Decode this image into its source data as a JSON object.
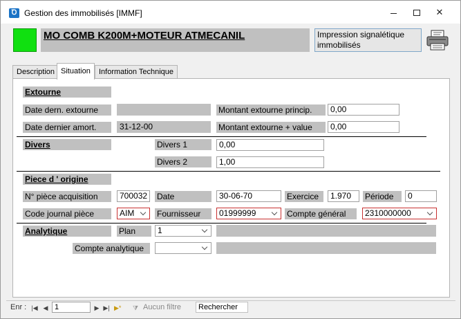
{
  "window": {
    "title": "Gestion des immobilisés [IMMF]"
  },
  "header": {
    "asset_name": "MO COMB K200M+MOTEUR ATMECANIL",
    "print_label": "Impression signalétique immobilisés",
    "status_color": "#10e010"
  },
  "tabs": [
    {
      "label": "Description"
    },
    {
      "label": "Situation"
    },
    {
      "label": "Information Technique"
    }
  ],
  "extourne": {
    "section": "Extourne",
    "date_dern_label": "Date dern. extourne",
    "date_dern_value": "",
    "date_amort_label": "Date dernier amort.",
    "date_amort_value": "31-12-00",
    "montant_princ_label": "Montant extourne princip.",
    "montant_princ_value": "0,00",
    "montant_value_label": "Montant extourne + value",
    "montant_value_value": "0,00"
  },
  "divers": {
    "section": "Divers",
    "d1_label": "Divers 1",
    "d1_value": "0,00",
    "d2_label": "Divers 2",
    "d2_value": "1,00"
  },
  "piece": {
    "section": "Piece d ' origine",
    "num_label": "N° pièce acquisition",
    "num_value": "700032",
    "date_label": "Date",
    "date_value": "30-06-70",
    "exercice_label": "Exercice",
    "exercice_value": "1.970",
    "periode_label": "Période",
    "periode_value": "0",
    "journal_label": "Code journal pièce",
    "journal_value": "AIM",
    "fournisseur_label": "Fournisseur",
    "fournisseur_value": "01999999",
    "compte_label": "Compte général",
    "compte_value": "2310000000"
  },
  "analytique": {
    "section": "Analytique",
    "plan_label": "Plan",
    "plan_value": "1",
    "compte_label": "Compte analytique",
    "compte_value": ""
  },
  "statusbar": {
    "record_label": "Enr :",
    "record_value": "1",
    "filter_label": "Aucun filtre",
    "search_label": "Rechercher"
  }
}
